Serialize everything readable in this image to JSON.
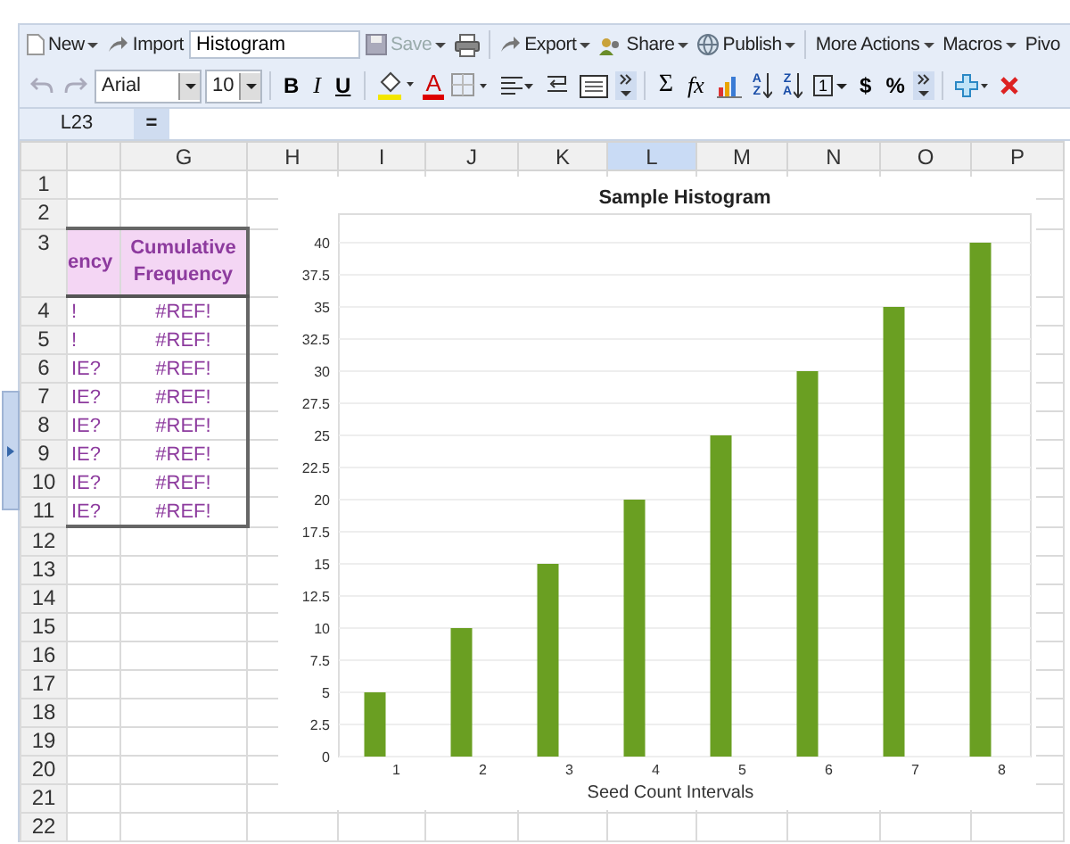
{
  "toolbar_primary": {
    "items": [
      {
        "kind": "new",
        "label": "New",
        "menu": true
      },
      {
        "kind": "import",
        "label": "Import",
        "menu": false
      },
      {
        "kind": "title",
        "value": "Histogram"
      },
      {
        "kind": "save",
        "label": "Save",
        "menu": true,
        "disabled": true
      },
      {
        "kind": "print"
      },
      {
        "kind": "export",
        "label": "Export",
        "menu": true
      },
      {
        "kind": "share",
        "label": "Share",
        "menu": true
      },
      {
        "kind": "publish",
        "label": "Publish",
        "menu": true
      },
      {
        "kind": "plain",
        "label": "More Actions",
        "menu": true
      },
      {
        "kind": "plain",
        "label": "Macros",
        "menu": true
      },
      {
        "kind": "plain",
        "label": "Pivo",
        "menu": false
      }
    ]
  },
  "toolbar_format": {
    "items": [
      {
        "kind": "undo",
        "disabled": true
      },
      {
        "kind": "redo",
        "disabled": true
      },
      {
        "kind": "font",
        "value": "Arial"
      },
      {
        "kind": "size",
        "value": "10"
      },
      {
        "kind": "bold",
        "text": "B"
      },
      {
        "kind": "italic",
        "text": "I"
      },
      {
        "kind": "underline",
        "text": "U"
      },
      {
        "kind": "fill"
      },
      {
        "kind": "fontcolor",
        "text": "A"
      },
      {
        "kind": "borders"
      },
      {
        "kind": "align"
      },
      {
        "kind": "wrap"
      },
      {
        "kind": "merge"
      },
      {
        "kind": "more"
      },
      {
        "kind": "sum",
        "text": "Σ"
      },
      {
        "kind": "function",
        "text": "fx"
      },
      {
        "kind": "chart"
      },
      {
        "kind": "sort",
        "top": "A",
        "bottom": "Z"
      },
      {
        "kind": "sort",
        "top": "Z",
        "bottom": "A"
      },
      {
        "kind": "number",
        "text": "1"
      },
      {
        "kind": "currency",
        "text": "$"
      },
      {
        "kind": "percent",
        "text": "%"
      },
      {
        "kind": "more"
      },
      {
        "kind": "add"
      },
      {
        "kind": "delete"
      }
    ]
  },
  "formula_bar": {
    "cell_ref": "L23",
    "symbol": "="
  },
  "sheet": {
    "columns": [
      {
        "selected": false
      },
      {
        "label": "G",
        "selected": false
      },
      {
        "label": "H",
        "selected": false
      },
      {
        "label": "I",
        "selected": false
      },
      {
        "label": "J",
        "selected": false
      },
      {
        "label": "K",
        "selected": false
      },
      {
        "label": "L",
        "selected": true
      },
      {
        "label": "M",
        "selected": false
      },
      {
        "label": "N",
        "selected": false
      },
      {
        "label": "O",
        "selected": false
      },
      {
        "label": "P",
        "selected": false
      }
    ],
    "rows": [
      {
        "number": "1",
        "cells": []
      },
      {
        "number": "2",
        "cells": []
      },
      {
        "number": "3",
        "kind": "header",
        "cells": [
          "ency",
          "Cumulative Frequency"
        ]
      },
      {
        "number": "4",
        "cells": [
          "!",
          "#REF!"
        ]
      },
      {
        "number": "5",
        "cells": [
          "!",
          "#REF!"
        ]
      },
      {
        "number": "6",
        "cells": [
          "IE?",
          "#REF!"
        ]
      },
      {
        "number": "7",
        "cells": [
          "IE?",
          "#REF!"
        ]
      },
      {
        "number": "8",
        "cells": [
          "IE?",
          "#REF!"
        ]
      },
      {
        "number": "9",
        "cells": [
          "IE?",
          "#REF!"
        ]
      },
      {
        "number": "10",
        "cells": [
          "IE?",
          "#REF!"
        ]
      },
      {
        "number": "11",
        "cells": [
          "IE?",
          "#REF!"
        ]
      },
      {
        "number": "12",
        "cells": []
      },
      {
        "number": "13",
        "cells": []
      },
      {
        "number": "14",
        "cells": []
      },
      {
        "number": "15",
        "cells": []
      },
      {
        "number": "16",
        "cells": []
      },
      {
        "number": "17",
        "cells": []
      },
      {
        "number": "18",
        "cells": []
      },
      {
        "number": "19",
        "cells": []
      },
      {
        "number": "20",
        "cells": []
      },
      {
        "number": "21",
        "cells": []
      },
      {
        "number": "22",
        "cells": []
      }
    ]
  },
  "chart": {
    "chart_data": {
      "type": "bar",
      "title": "Sample Histogram",
      "xlabel": "Seed Count Intervals",
      "categories": [
        "1",
        "2",
        "3",
        "4",
        "5",
        "6",
        "7",
        "8"
      ],
      "series": [
        {
          "color": "#6a9f22",
          "values": [
            5,
            10,
            15,
            20,
            25,
            30,
            35,
            40
          ]
        }
      ],
      "ylim": [
        0,
        40
      ],
      "yticks": [
        0,
        2.5,
        5,
        7.5,
        10,
        12.5,
        15,
        17.5,
        20,
        22.5,
        25,
        27.5,
        30,
        32.5,
        35,
        37.5,
        40
      ],
      "grid": true
    }
  }
}
